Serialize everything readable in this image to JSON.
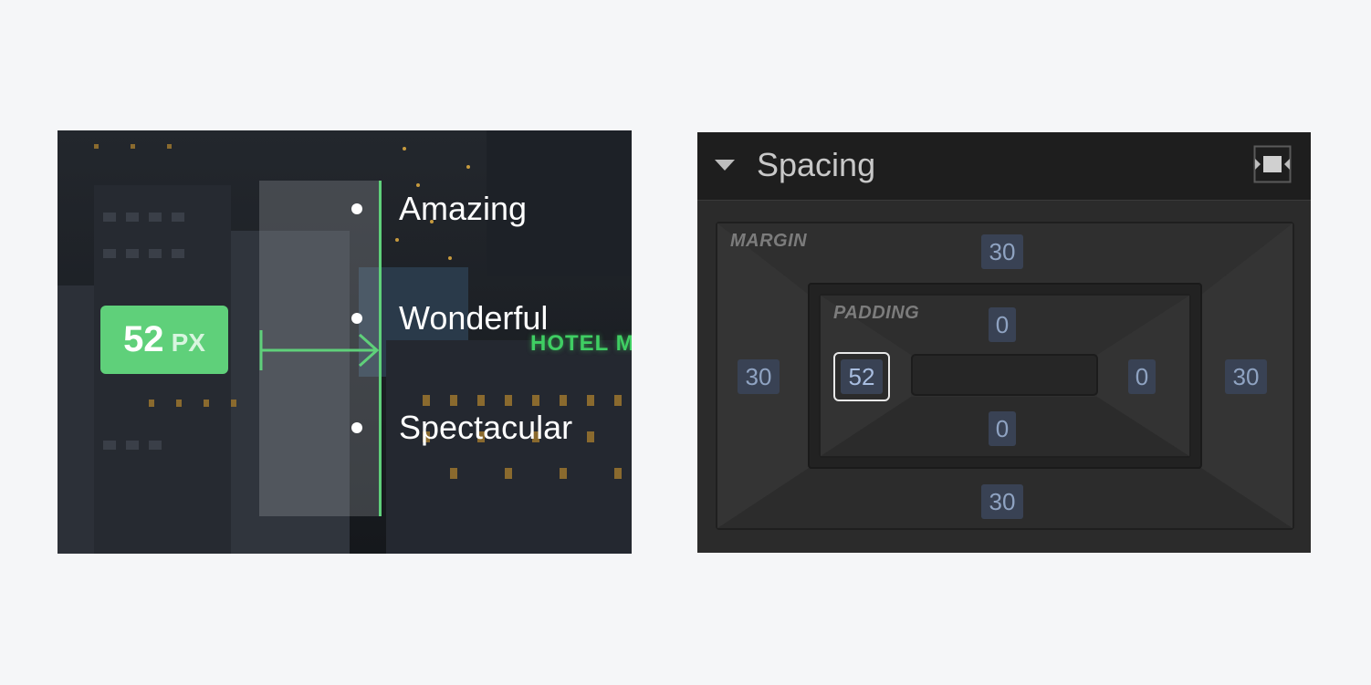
{
  "illustration": {
    "padding_badge": {
      "value": "52",
      "unit": "PX"
    },
    "list_items": [
      "Amazing",
      "Wonderful",
      "Spectacular"
    ],
    "sign_text": "HOTEL METR",
    "accent_color": "#5fd07a"
  },
  "spacing_panel": {
    "title": "Spacing",
    "collapse_icon": "caret-down-icon",
    "mode_icon": "box-model-icon",
    "margin": {
      "label": "MARGIN",
      "top": "30",
      "right": "30",
      "bottom": "30",
      "left": "30"
    },
    "padding": {
      "label": "PADDING",
      "top": "0",
      "right": "0",
      "bottom": "0",
      "left": "52"
    },
    "active_field": "padding-left",
    "colors": {
      "panel_bg": "#2b2b2b",
      "header_bg": "#1e1e1e",
      "value_bg": "#394254",
      "value_text": "#8fa3c2"
    }
  }
}
